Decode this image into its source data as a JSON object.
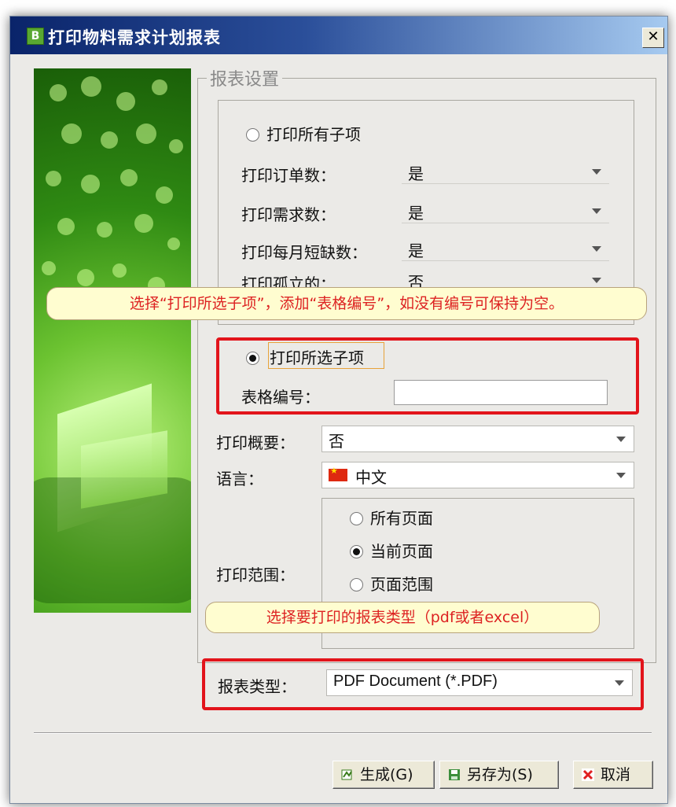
{
  "window": {
    "title": "打印物料需求计划报表",
    "logo_text": "B",
    "close_glyph": "✕"
  },
  "group": {
    "title": "报表设置"
  },
  "all_subitems": {
    "radio_label": "打印所有子项",
    "rows": [
      {
        "label": "打印订单数：",
        "value": "是"
      },
      {
        "label": "打印需求数：",
        "value": "是"
      },
      {
        "label": "打印每月短缺数：",
        "value": "是"
      },
      {
        "label": "打印孤立的：",
        "value": "否"
      }
    ]
  },
  "selected_subitems": {
    "radio_label": "打印所选子项",
    "table_number_label": "表格编号：",
    "table_number_value": ""
  },
  "summary": {
    "label": "打印概要：",
    "value": "否"
  },
  "language": {
    "label": "语言：",
    "value": "中文",
    "flag_icon": "china-flag-icon"
  },
  "print_range": {
    "label": "打印范围：",
    "options": [
      "所有页面",
      "当前页面",
      "页面范围"
    ],
    "selected": "当前页面"
  },
  "report_type": {
    "label": "报表类型：",
    "value": "PDF Document (*.PDF)"
  },
  "callouts": {
    "top": "选择“打印所选子项”，添加“表格编号”，如没有编号可保持为空。",
    "bottom": "选择要打印的报表类型（pdf或者excel）"
  },
  "buttons": {
    "generate": "生成(G)",
    "save_as": "另存为(S)",
    "cancel": "取消"
  },
  "colors": {
    "highlight_red": "#e2141b",
    "callout_text": "#dd2222",
    "titlebar": "#0a246a"
  }
}
